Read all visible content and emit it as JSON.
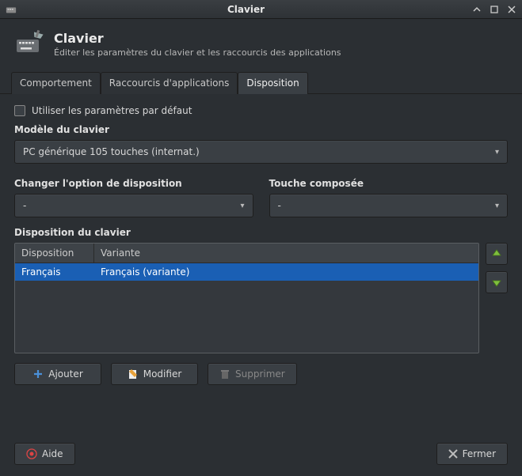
{
  "window": {
    "title": "Clavier"
  },
  "header": {
    "title": "Clavier",
    "subtitle": "Éditer les paramètres du clavier et les raccourcis des applications"
  },
  "tabs": [
    {
      "label": "Comportement"
    },
    {
      "label": "Raccourcis d'applications"
    },
    {
      "label": "Disposition"
    }
  ],
  "defaults_checkbox": {
    "label": "Utiliser les paramètres par défaut"
  },
  "model": {
    "label": "Modèle du clavier",
    "value": "PC générique 105 touches (internat.)"
  },
  "layout_option": {
    "label": "Changer l'option de disposition",
    "value": "-"
  },
  "compose": {
    "label": "Touche composée",
    "value": "-"
  },
  "layout_table": {
    "label": "Disposition du clavier",
    "columns": [
      "Disposition",
      "Variante"
    ],
    "rows": [
      {
        "disposition": "Français",
        "variante": "Français (variante)"
      }
    ]
  },
  "buttons": {
    "add": "Ajouter",
    "edit": "Modifier",
    "remove": "Supprimer",
    "help": "Aide",
    "close": "Fermer"
  }
}
